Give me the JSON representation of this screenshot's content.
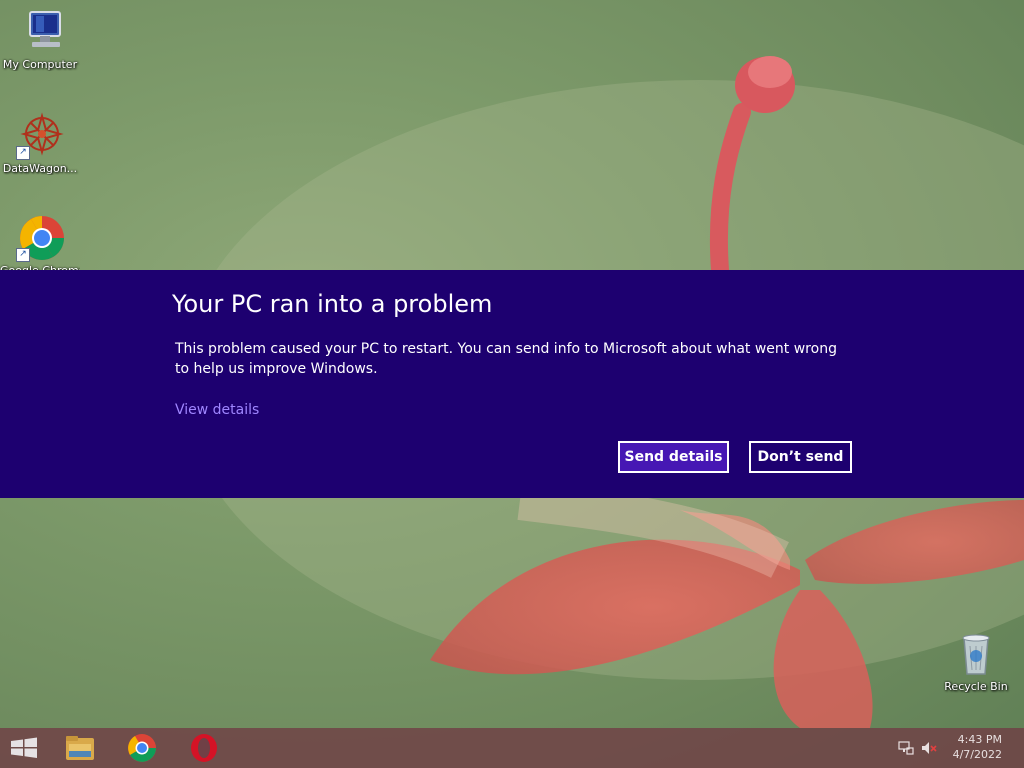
{
  "desktop_icons": [
    {
      "name": "my-computer",
      "label": "My Computer",
      "icon": "computer-icon",
      "shortcut": false
    },
    {
      "name": "datawagon",
      "label": "DataWagon...",
      "icon": "datawagon-icon",
      "shortcut": true
    },
    {
      "name": "google-chrome",
      "label": "Google Chrome",
      "icon": "chrome-icon",
      "shortcut": true
    },
    {
      "name": "recycle-bin",
      "label": "Recycle Bin",
      "icon": "recycle-bin-icon",
      "shortcut": false
    }
  ],
  "dialog": {
    "title": "Your PC ran into a problem",
    "message": "This problem caused your PC to restart. You can send info to Microsoft about what went wrong to help us improve Windows.",
    "view_details": "View details",
    "send_button": "Send details",
    "dont_send_button": "Don’t send",
    "background_color": "#1d0070",
    "link_color": "#9f86ff",
    "primary_button_color": "#4617b4"
  },
  "taskbar": {
    "items": [
      "windows-start-icon",
      "file-explorer-icon",
      "chrome-icon",
      "opera-icon"
    ],
    "tray_icons": [
      "network-icon",
      "volume-muted-icon"
    ],
    "time": "4:43 PM",
    "date": "4/7/2022"
  }
}
